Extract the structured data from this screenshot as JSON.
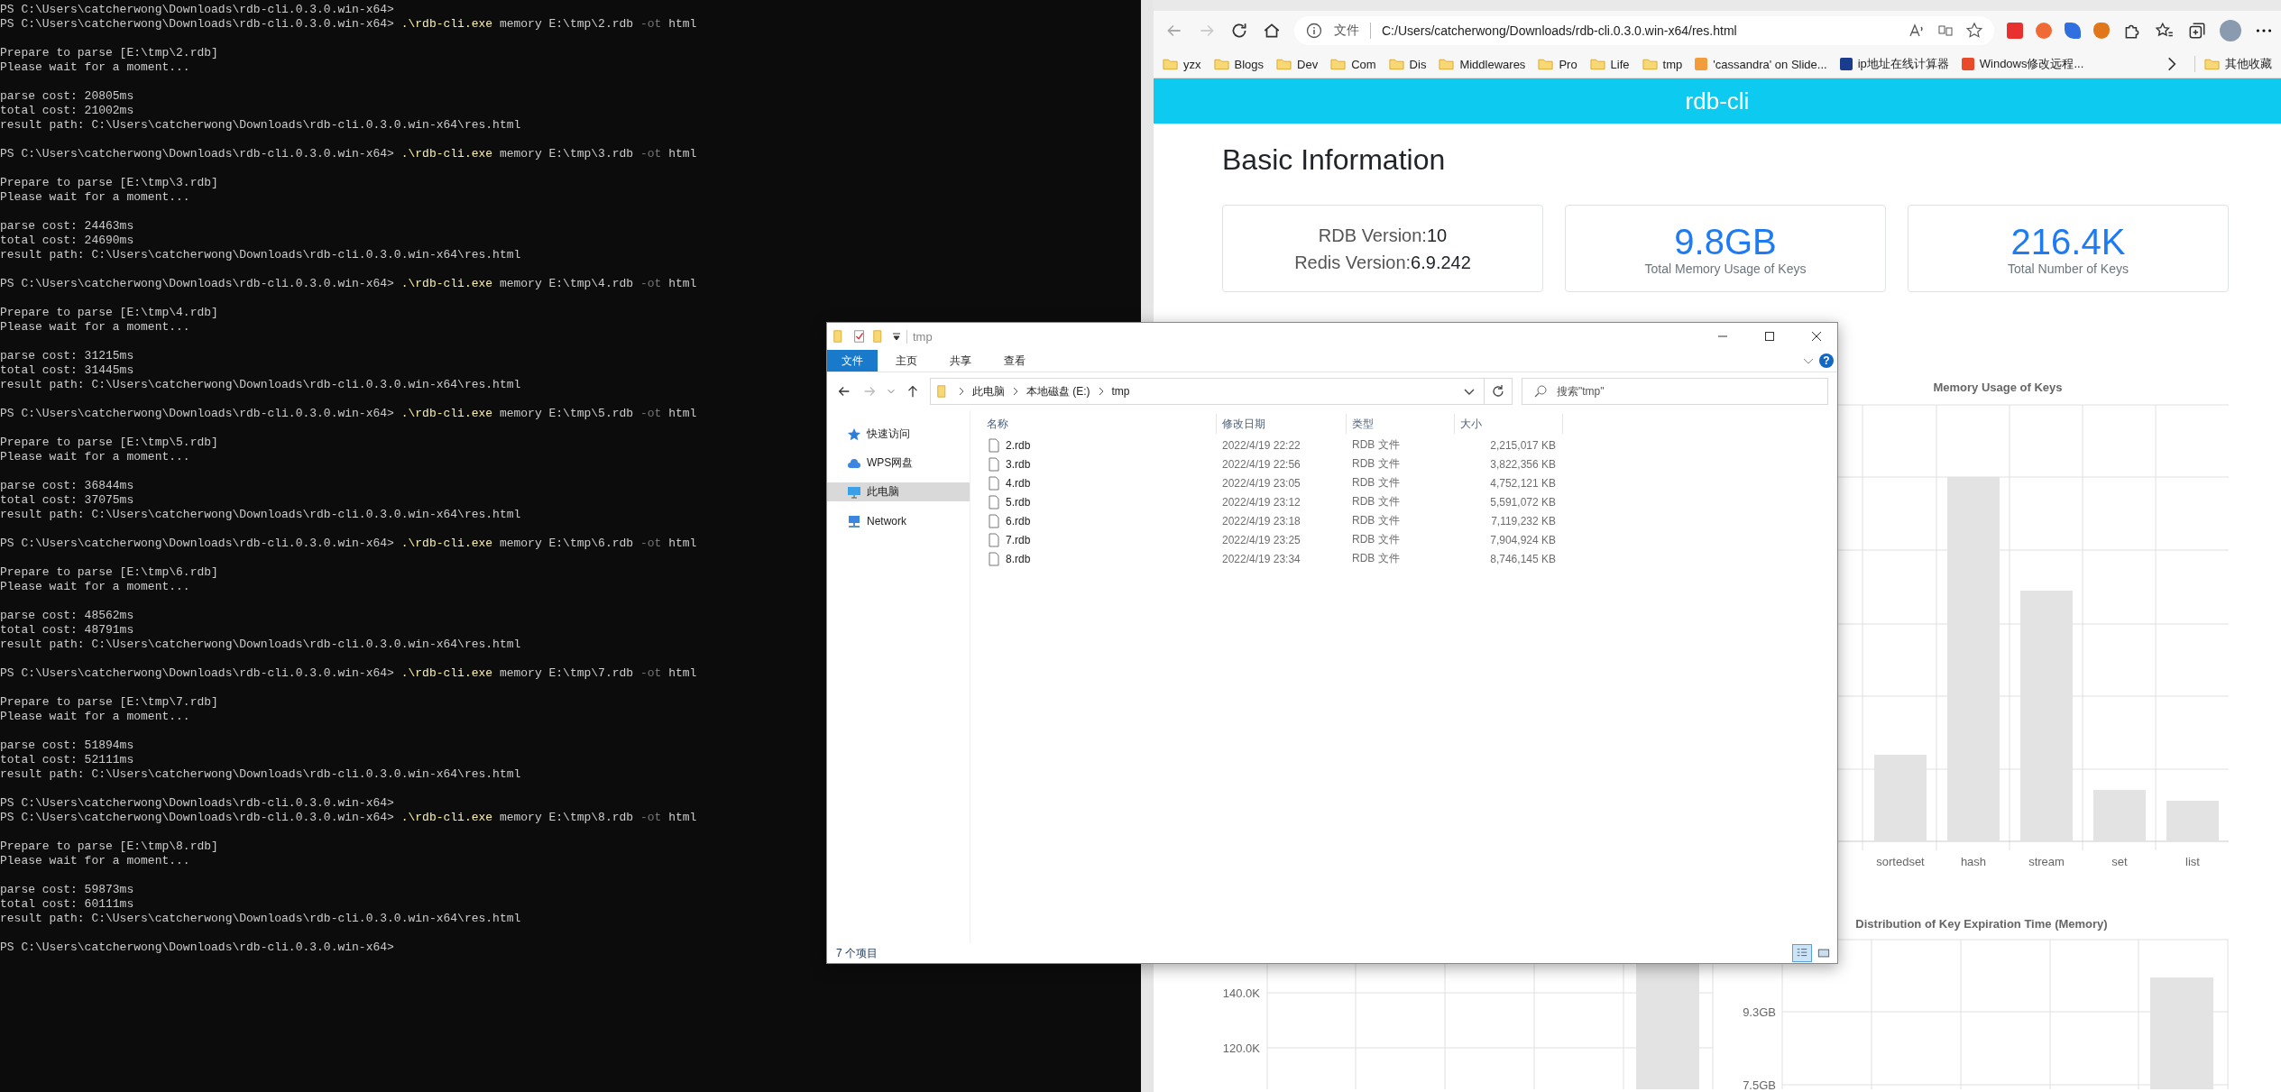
{
  "terminal": {
    "lines": [
      {
        "kind": "text",
        "text": "PS C:\\Users\\catcherwong\\Downloads\\rdb-cli.0.3.0.win-x64>"
      },
      {
        "kind": "command",
        "prompt": "PS C:\\Users\\catcherwong\\Downloads\\rdb-cli.0.3.0.win-x64>",
        "exe": ".\\rdb-cli.exe",
        "args": "memory E:\\tmp\\2.rdb",
        "flag": "-ot",
        "format": "html"
      },
      {
        "kind": "blank"
      },
      {
        "kind": "text",
        "text": "Prepare to parse [E:\\tmp\\2.rdb]"
      },
      {
        "kind": "text",
        "text": "Please wait for a moment..."
      },
      {
        "kind": "blank"
      },
      {
        "kind": "text",
        "text": "parse cost: 20805ms"
      },
      {
        "kind": "text",
        "text": "total cost: 21002ms"
      },
      {
        "kind": "text",
        "text": "result path: C:\\Users\\catcherwong\\Downloads\\rdb-cli.0.3.0.win-x64\\res.html"
      },
      {
        "kind": "blank"
      },
      {
        "kind": "command",
        "prompt": "PS C:\\Users\\catcherwong\\Downloads\\rdb-cli.0.3.0.win-x64>",
        "exe": ".\\rdb-cli.exe",
        "args": "memory E:\\tmp\\3.rdb",
        "flag": "-ot",
        "format": "html"
      },
      {
        "kind": "blank"
      },
      {
        "kind": "text",
        "text": "Prepare to parse [E:\\tmp\\3.rdb]"
      },
      {
        "kind": "text",
        "text": "Please wait for a moment..."
      },
      {
        "kind": "blank"
      },
      {
        "kind": "text",
        "text": "parse cost: 24463ms"
      },
      {
        "kind": "text",
        "text": "total cost: 24690ms"
      },
      {
        "kind": "text",
        "text": "result path: C:\\Users\\catcherwong\\Downloads\\rdb-cli.0.3.0.win-x64\\res.html"
      },
      {
        "kind": "blank"
      },
      {
        "kind": "command",
        "prompt": "PS C:\\Users\\catcherwong\\Downloads\\rdb-cli.0.3.0.win-x64>",
        "exe": ".\\rdb-cli.exe",
        "args": "memory E:\\tmp\\4.rdb",
        "flag": "-ot",
        "format": "html"
      },
      {
        "kind": "blank"
      },
      {
        "kind": "text",
        "text": "Prepare to parse [E:\\tmp\\4.rdb]"
      },
      {
        "kind": "text",
        "text": "Please wait for a moment..."
      },
      {
        "kind": "blank"
      },
      {
        "kind": "text",
        "text": "parse cost: 31215ms"
      },
      {
        "kind": "text",
        "text": "total cost: 31445ms"
      },
      {
        "kind": "text",
        "text": "result path: C:\\Users\\catcherwong\\Downloads\\rdb-cli.0.3.0.win-x64\\res.html"
      },
      {
        "kind": "blank"
      },
      {
        "kind": "command",
        "prompt": "PS C:\\Users\\catcherwong\\Downloads\\rdb-cli.0.3.0.win-x64>",
        "exe": ".\\rdb-cli.exe",
        "args": "memory E:\\tmp\\5.rdb",
        "flag": "-ot",
        "format": "html"
      },
      {
        "kind": "blank"
      },
      {
        "kind": "text",
        "text": "Prepare to parse [E:\\tmp\\5.rdb]"
      },
      {
        "kind": "text",
        "text": "Please wait for a moment..."
      },
      {
        "kind": "blank"
      },
      {
        "kind": "text",
        "text": "parse cost: 36844ms"
      },
      {
        "kind": "text",
        "text": "total cost: 37075ms"
      },
      {
        "kind": "text",
        "text": "result path: C:\\Users\\catcherwong\\Downloads\\rdb-cli.0.3.0.win-x64\\res.html"
      },
      {
        "kind": "blank"
      },
      {
        "kind": "command",
        "prompt": "PS C:\\Users\\catcherwong\\Downloads\\rdb-cli.0.3.0.win-x64>",
        "exe": ".\\rdb-cli.exe",
        "args": "memory E:\\tmp\\6.rdb",
        "flag": "-ot",
        "format": "html"
      },
      {
        "kind": "blank"
      },
      {
        "kind": "text",
        "text": "Prepare to parse [E:\\tmp\\6.rdb]"
      },
      {
        "kind": "text",
        "text": "Please wait for a moment..."
      },
      {
        "kind": "blank"
      },
      {
        "kind": "text",
        "text": "parse cost: 48562ms"
      },
      {
        "kind": "text",
        "text": "total cost: 48791ms"
      },
      {
        "kind": "text",
        "text": "result path: C:\\Users\\catcherwong\\Downloads\\rdb-cli.0.3.0.win-x64\\res.html"
      },
      {
        "kind": "blank"
      },
      {
        "kind": "command",
        "prompt": "PS C:\\Users\\catcherwong\\Downloads\\rdb-cli.0.3.0.win-x64>",
        "exe": ".\\rdb-cli.exe",
        "args": "memory E:\\tmp\\7.rdb",
        "flag": "-ot",
        "format": "html"
      },
      {
        "kind": "blank"
      },
      {
        "kind": "text",
        "text": "Prepare to parse [E:\\tmp\\7.rdb]"
      },
      {
        "kind": "text",
        "text": "Please wait for a moment..."
      },
      {
        "kind": "blank"
      },
      {
        "kind": "text",
        "text": "parse cost: 51894ms"
      },
      {
        "kind": "text",
        "text": "total cost: 52111ms"
      },
      {
        "kind": "text",
        "text": "result path: C:\\Users\\catcherwong\\Downloads\\rdb-cli.0.3.0.win-x64\\res.html"
      },
      {
        "kind": "blank"
      },
      {
        "kind": "text",
        "text": "PS C:\\Users\\catcherwong\\Downloads\\rdb-cli.0.3.0.win-x64>"
      },
      {
        "kind": "command",
        "prompt": "PS C:\\Users\\catcherwong\\Downloads\\rdb-cli.0.3.0.win-x64>",
        "exe": ".\\rdb-cli.exe",
        "args": "memory E:\\tmp\\8.rdb",
        "flag": "-ot",
        "format": "html"
      },
      {
        "kind": "blank"
      },
      {
        "kind": "text",
        "text": "Prepare to parse [E:\\tmp\\8.rdb]"
      },
      {
        "kind": "text",
        "text": "Please wait for a moment..."
      },
      {
        "kind": "blank"
      },
      {
        "kind": "text",
        "text": "parse cost: 59873ms"
      },
      {
        "kind": "text",
        "text": "total cost: 60111ms"
      },
      {
        "kind": "text",
        "text": "result path: C:\\Users\\catcherwong\\Downloads\\rdb-cli.0.3.0.win-x64\\res.html"
      },
      {
        "kind": "blank"
      },
      {
        "kind": "text",
        "text": "PS C:\\Users\\catcherwong\\Downloads\\rdb-cli.0.3.0.win-x64>"
      }
    ]
  },
  "browser": {
    "address": {
      "scheme": "文件",
      "url": "C:/Users/catcherwong/Downloads/rdb-cli.0.3.0.win-x64/res.html"
    },
    "bookmarks": [
      {
        "kind": "folder",
        "label": "yzx"
      },
      {
        "kind": "folder",
        "label": "Blogs"
      },
      {
        "kind": "folder",
        "label": "Dev"
      },
      {
        "kind": "folder",
        "label": "Com"
      },
      {
        "kind": "folder",
        "label": "Dis"
      },
      {
        "kind": "folder",
        "label": "Middlewares"
      },
      {
        "kind": "folder",
        "label": "Pro"
      },
      {
        "kind": "folder",
        "label": "Life"
      },
      {
        "kind": "folder",
        "label": "tmp"
      },
      {
        "kind": "site",
        "label": "'cassandra' on Slide...",
        "color": "#f39c3c"
      },
      {
        "kind": "site",
        "label": "ip地址在线计算器",
        "color": "#1a3c8c"
      },
      {
        "kind": "site",
        "label": "Windows修改远程...",
        "color": "#e84a2a"
      }
    ],
    "other_bookmarks": "其他收藏"
  },
  "page": {
    "header": "rdb-cli",
    "section_title": "Basic Information",
    "version_card": {
      "rdb_label": "RDB Version:",
      "rdb_value": "10",
      "redis_label": "Redis Version:",
      "redis_value": "6.9.242"
    },
    "stat_cards": [
      {
        "value": "9.8GB",
        "label": "Total Memory Usage of Keys"
      },
      {
        "value": "216.4K",
        "label": "Total Number of Keys"
      }
    ],
    "memory_chart": {
      "title": "Memory Usage of Keys",
      "categories": [
        "sortedset",
        "hash",
        "stream",
        "set",
        "list"
      ]
    },
    "count_chart": {
      "yticks": [
        "140.0K",
        "120.0K"
      ]
    },
    "expiration_chart": {
      "title": "Distribution of Key Expiration Time (Memory)",
      "yticks": [
        "9.3GB",
        "7.5GB"
      ]
    }
  },
  "explorer": {
    "title": "tmp",
    "ribbon_tabs": [
      {
        "label": "文件",
        "selected": true
      },
      {
        "label": "主页",
        "selected": false
      },
      {
        "label": "共享",
        "selected": false
      },
      {
        "label": "查看",
        "selected": false
      }
    ],
    "help": "?",
    "breadcrumb": [
      "此电脑",
      "本地磁盘 (E:)",
      "tmp"
    ],
    "search": {
      "placeholder": "搜索\"tmp\""
    },
    "nav": [
      {
        "kind": "star",
        "label": "快速访问",
        "selected": false
      },
      {
        "kind": "cloud",
        "label": "WPS网盘",
        "selected": false
      },
      {
        "kind": "pc",
        "label": "此电脑",
        "selected": true
      },
      {
        "kind": "network",
        "label": "Network",
        "selected": false
      }
    ],
    "columns": [
      "名称",
      "修改日期",
      "类型",
      "大小"
    ],
    "files": [
      {
        "name": "2.rdb",
        "modified": "2022/4/19 22:22",
        "type": "RDB 文件",
        "size": "2,215,017 KB"
      },
      {
        "name": "3.rdb",
        "modified": "2022/4/19 22:56",
        "type": "RDB 文件",
        "size": "3,822,356 KB"
      },
      {
        "name": "4.rdb",
        "modified": "2022/4/19 23:05",
        "type": "RDB 文件",
        "size": "4,752,121 KB"
      },
      {
        "name": "5.rdb",
        "modified": "2022/4/19 23:12",
        "type": "RDB 文件",
        "size": "5,591,072 KB"
      },
      {
        "name": "6.rdb",
        "modified": "2022/4/19 23:18",
        "type": "RDB 文件",
        "size": "7,119,232 KB"
      },
      {
        "name": "7.rdb",
        "modified": "2022/4/19 23:25",
        "type": "RDB 文件",
        "size": "7,904,924 KB"
      },
      {
        "name": "8.rdb",
        "modified": "2022/4/19 23:34",
        "type": "RDB 文件",
        "size": "8,746,145 KB"
      }
    ],
    "status": "7 个项目",
    "views": [
      {
        "kind": "details",
        "selected": true
      },
      {
        "kind": "thumbnails",
        "selected": false
      }
    ]
  }
}
